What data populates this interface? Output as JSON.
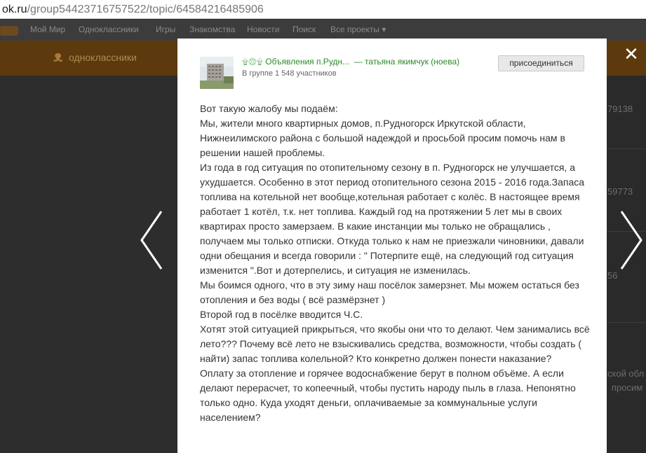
{
  "browser": {
    "url_host": "ok.ru",
    "url_path": "/group54423716757522/topic/64584216485906"
  },
  "background": {
    "topnav": [
      "Мой Мир",
      "Одноклассники",
      "Игры",
      "Знакомства",
      "Новости",
      "Поиск",
      "Все проекты ▾"
    ],
    "site_name": "одноклассники",
    "peek_numbers": [
      "79138",
      "59773",
      "56"
    ],
    "peek_text": [
      "ской обл",
      "просим"
    ]
  },
  "modal": {
    "group_name": "Объявления п.Рудн...",
    "group_name_emoji": "۩۞۩",
    "author": "— татьяна якимчук (ноева)",
    "group_members": "В группе 1 548 участников",
    "join_label": "присоединиться",
    "close_label": "✕",
    "post_lines": [
      "Вот такую жалобу мы подаём:",
      "Мы, жители много квартирных домов, п.Рудногорск Иркутской области, Нижнеилимского района с большой надеждой и просьбой просим помочь нам в решении нашей проблемы.",
      "Из года в год ситуация по отопительному сезону в п. Рудногорск не улучшается, а ухудшается. Особенно в этот период отопительного сезона 2015 - 2016 года.Запаса топлива на котельной нет вообще,котельная работает с колёс. В настоящее время работает 1 котёл, т.к. нет топлива. Каждый год на протяжении 5 лет мы в своих квартирах просто замерзаем. В какие инстанции мы только не обращались , получаем мы только отписки. Откуда только к нам не приезжали чиновники, давали одни обещания и всегда говорили : \" Потерпите ещё, на следующий год ситуация изменится \".Вот и дотерпелись, и ситуация не изменилась.",
      "Мы боимся одного, что в эту зиму наш посёлок замерзнет. Мы можем остаться без отопления и без воды ( всё размёрзнет )",
      "Второй год в посёлке вводится Ч.С.",
      "Хотят этой ситуацией прикрыться, что якобы они что то делают. Чем занимались всё лето??? Почему всё лето не взыскивались средства, возможности, чтобы создать ( найти) запас топлива колельной? Кто конкретно должен понести наказание?",
      "Оплату за отопление и горячее водоснабжение берут в полном объёме. А если делают перерасчет, то копеечный, чтобы пустить народу пыль в глаза. Непонятно только одно. Куда уходят деньги, оплачиваемые за коммунальные услуги населением?"
    ]
  }
}
